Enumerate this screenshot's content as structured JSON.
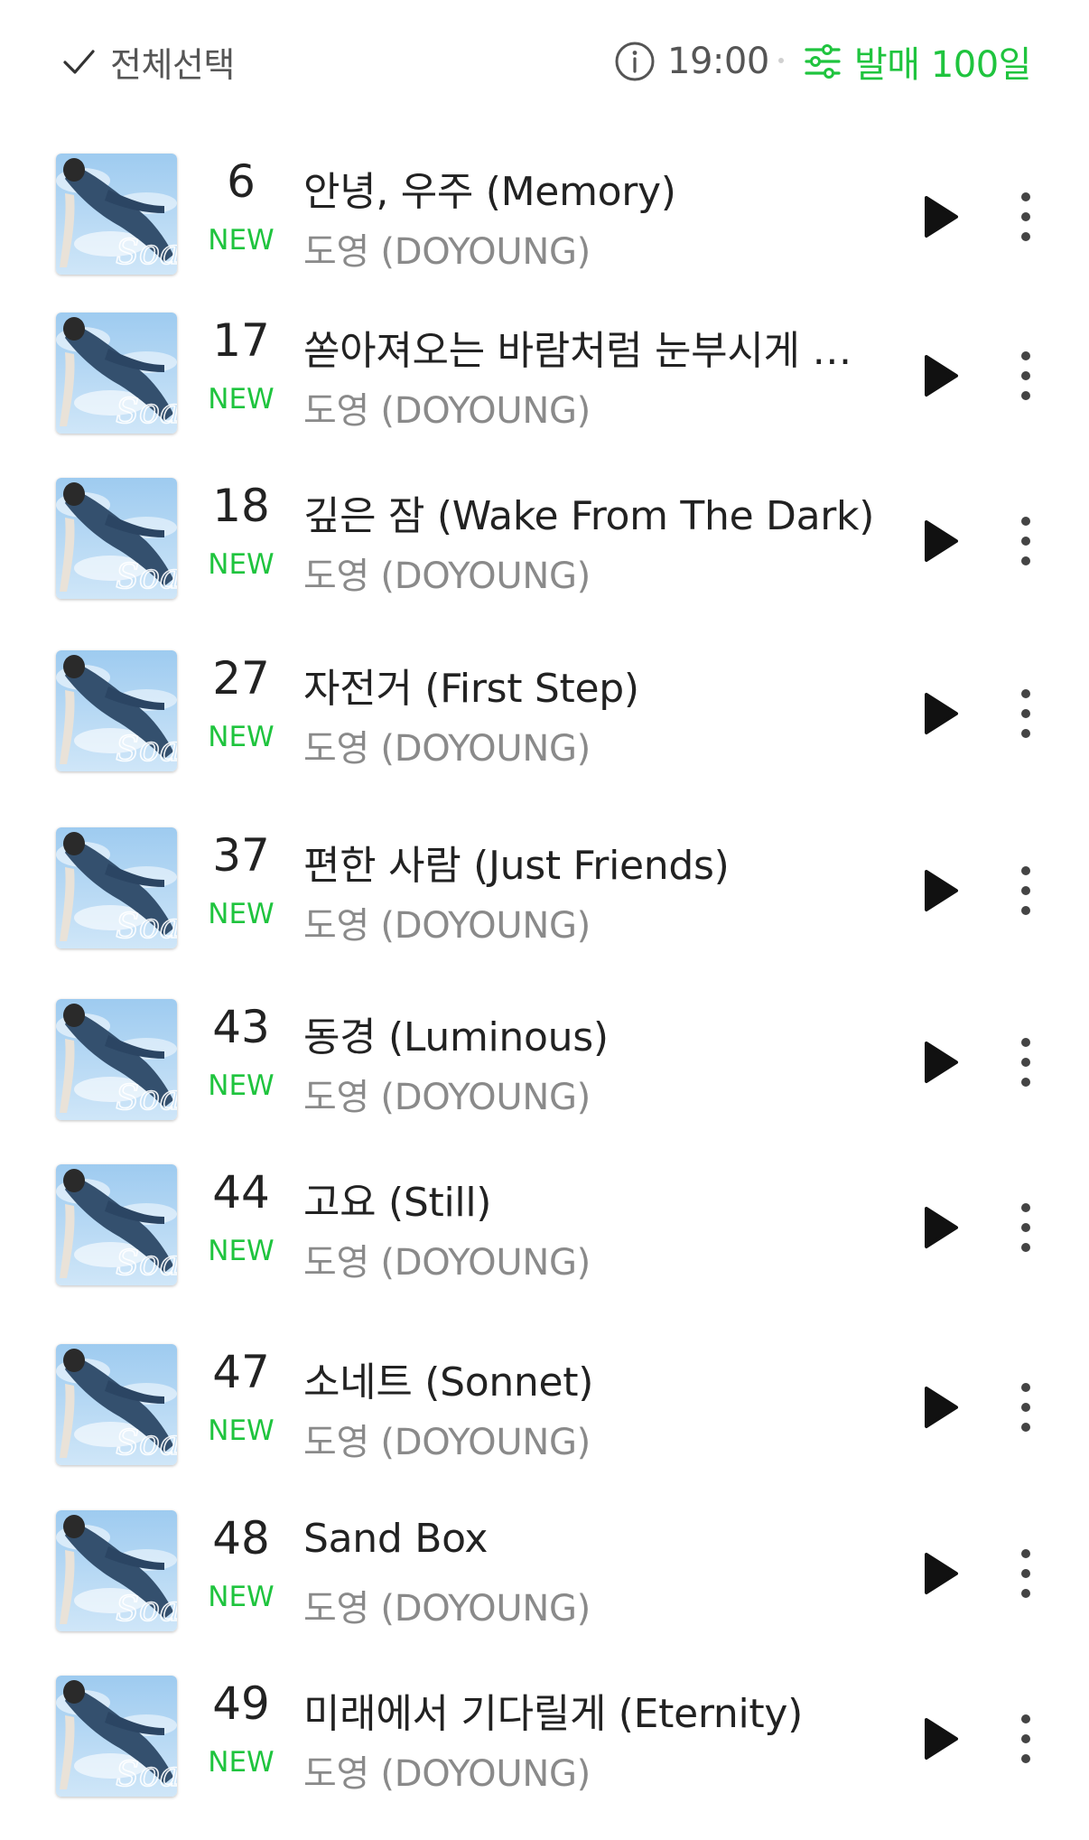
{
  "colors": {
    "accent": "#1fc43e",
    "text_primary": "#222222",
    "text_secondary": "#8a8a8a",
    "play": "#111111"
  },
  "header": {
    "select_all_label": "전체선택",
    "select_all_icon": "check-icon",
    "time_icon": "info-circle-icon",
    "time_label": "19:00",
    "filter_icon": "sliders-icon",
    "filter_label": "발매 100일"
  },
  "tracks": [
    {
      "rank": "6",
      "badge": "NEW",
      "title": "안녕, 우주 (Memory)",
      "artist": "도영 (DOYOUNG)"
    },
    {
      "rank": "17",
      "badge": "NEW",
      "title": "쏟아져오는 바람처럼 눈부시게 너…",
      "artist": "도영 (DOYOUNG)"
    },
    {
      "rank": "18",
      "badge": "NEW",
      "title": "깊은 잠 (Wake From The Dark)",
      "artist": "도영 (DOYOUNG)"
    },
    {
      "rank": "27",
      "badge": "NEW",
      "title": "자전거 (First Step)",
      "artist": "도영 (DOYOUNG)"
    },
    {
      "rank": "37",
      "badge": "NEW",
      "title": "편한 사람 (Just Friends)",
      "artist": "도영 (DOYOUNG)"
    },
    {
      "rank": "43",
      "badge": "NEW",
      "title": "동경 (Luminous)",
      "artist": "도영 (DOYOUNG)"
    },
    {
      "rank": "44",
      "badge": "NEW",
      "title": "고요 (Still)",
      "artist": "도영 (DOYOUNG)"
    },
    {
      "rank": "47",
      "badge": "NEW",
      "title": "소네트 (Sonnet)",
      "artist": "도영 (DOYOUNG)"
    },
    {
      "rank": "48",
      "badge": "NEW",
      "title": "Sand Box",
      "artist": "도영 (DOYOUNG)"
    },
    {
      "rank": "49",
      "badge": "NEW",
      "title": "미래에서 기다릴게 (Eternity)",
      "artist": "도영 (DOYOUNG)"
    }
  ],
  "album_art_text": "Soar",
  "row_icons": {
    "play": "play-icon",
    "more": "more-vertical-icon"
  }
}
